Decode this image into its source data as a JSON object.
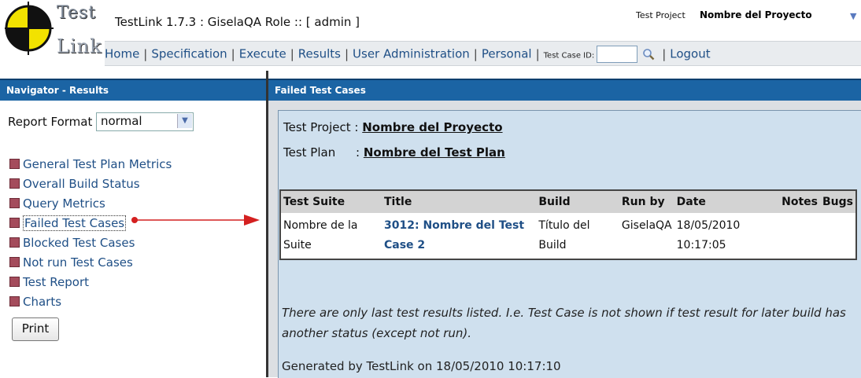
{
  "header": {
    "logo_word1": "Test",
    "logo_word2": "Link",
    "app_title": "TestLink 1.7.3 : GiselaQA Role :: [ admin ]",
    "project_label": "Test Project",
    "project_name": "Nombre del Proyecto"
  },
  "menu": {
    "home": "Home",
    "specification": "Specification",
    "execute": "Execute",
    "results": "Results",
    "user_admin": "User Administration",
    "personal": "Personal",
    "separator": "|",
    "test_case_id_label": "Test Case ID:",
    "logout": "Logout"
  },
  "navigator": {
    "title": "Navigator - Results",
    "report_format_label": "Report Format",
    "report_format_value": "normal",
    "items": [
      "General Test Plan Metrics",
      "Overall Build Status",
      "Query Metrics",
      "Failed Test Cases",
      "Blocked Test Cases",
      "Not run Test Cases",
      "Test Report",
      "Charts"
    ],
    "print_label": "Print"
  },
  "main": {
    "title": "Failed Test Cases",
    "test_project_label": "Test Project :",
    "test_project_value": "Nombre del Proyecto",
    "test_plan_label": "Test Plan",
    "test_plan_sep": ":",
    "test_plan_value": "Nombre del Test Plan",
    "table": {
      "headers": [
        "Test Suite",
        "Title",
        "Build",
        "Run by",
        "Date",
        "Notes",
        "Bugs"
      ],
      "row": {
        "suite": "Nombre de la Suite",
        "title": "3012: Nombre del Test Case 2",
        "build": "Título del Build",
        "run_by": "GiselaQA",
        "date": "18/05/2010 10:17:05",
        "notes": "",
        "bugs": ""
      }
    },
    "note": "There are only last test results listed. I.e. Test Case is not shown if test result for later build has another status (except not run).",
    "generated": "Generated by TestLink on 18/05/2010 10:17:10"
  },
  "colors": {
    "panel_header": "#1b64a4",
    "content_bg": "#cfe0ee",
    "link": "#1f4f86",
    "bullet": "#a44c5c",
    "arrow": "#d42020"
  }
}
